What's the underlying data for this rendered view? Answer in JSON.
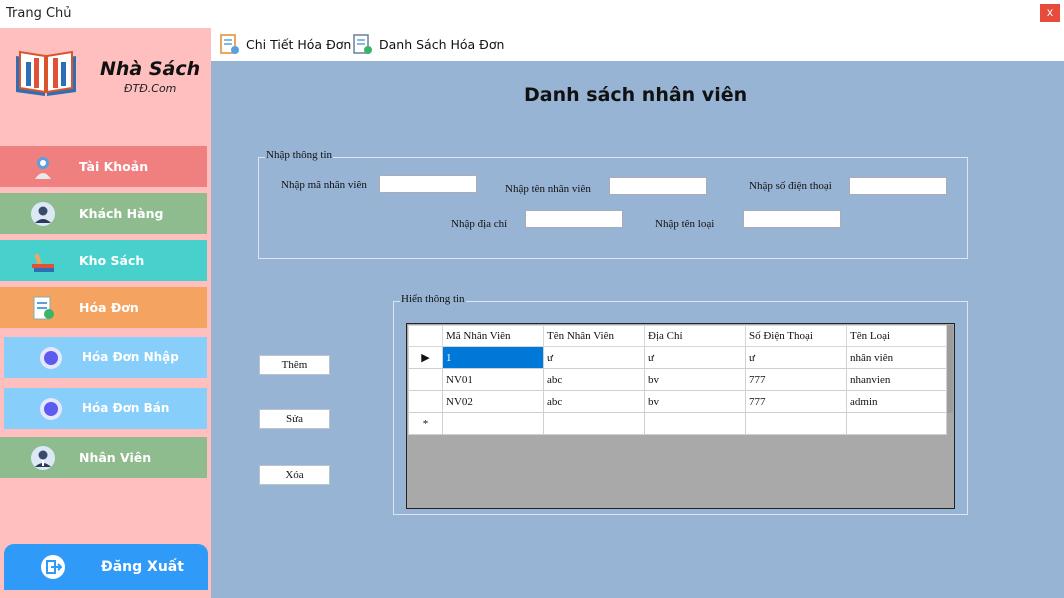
{
  "window": {
    "title": "Trang Chủ",
    "close_glyph": "x"
  },
  "brand": {
    "name": "Nhà Sách",
    "sub": "ĐTĐ.Com",
    "logo_icon": "book-logo-icon"
  },
  "sidebar": {
    "items": [
      {
        "label": "Tài Khoản",
        "icon": "account-icon",
        "color": "#f08080"
      },
      {
        "label": "Khách Hàng",
        "icon": "customer-icon",
        "color": "#8fbc8f"
      },
      {
        "label": "Kho Sách",
        "icon": "books-icon",
        "color": "#48d1cc"
      },
      {
        "label": "Hóa Đơn",
        "icon": "invoice-icon",
        "color": "#f4a460"
      },
      {
        "label": "Hóa Đơn Nhập",
        "icon": "circle-icon",
        "color": "#87cefa"
      },
      {
        "label": "Hóa Đơn Bán",
        "icon": "circle-icon",
        "color": "#87cefa"
      },
      {
        "label": "Nhân Viên",
        "icon": "employee-icon",
        "color": "#8fbc8f"
      }
    ],
    "logout": {
      "label": "Đăng Xuất",
      "color": "#2f9af7",
      "icon": "logout-icon"
    }
  },
  "toolbar": {
    "invoice_detail": "Chi Tiết Hóa Đơn",
    "invoice_list": "Danh Sách Hóa Đơn"
  },
  "main": {
    "heading": "Danh sách nhân viên",
    "input_group": {
      "legend": "Nhập thông tin",
      "id_label": "Nhập mã nhân viên",
      "name_label": "Nhập tên nhân viên",
      "phone_label": "Nhập số điện thoại",
      "address_label": "Nhập địa chỉ",
      "type_label": "Nhập tên loại",
      "id_value": "",
      "name_value": "",
      "phone_value": "",
      "address_value": "",
      "type_value": ""
    },
    "buttons": {
      "add": "Thêm",
      "edit": "Sửa",
      "delete": "Xóa"
    },
    "display_group": {
      "legend": "Hiển thông tin"
    },
    "table": {
      "columns": [
        "Mã Nhân Viên",
        "Tên Nhân Viên",
        "Địa Chỉ",
        "Số Điện Thoại",
        "Tên Loại"
      ],
      "rows": [
        [
          "1",
          "ư",
          "ư",
          "ư",
          "nhân viên"
        ],
        [
          "NV01",
          "abc",
          "bv",
          "777",
          "nhanvien"
        ],
        [
          "NV02",
          "abc",
          "bv",
          "777",
          "admin"
        ]
      ],
      "current_row_marker": "▶",
      "new_row_marker": "*"
    }
  },
  "colors": {
    "content_bg": "#98b4d4",
    "sidebar_bg": "#ffbfbf",
    "selection": "#0078d7"
  }
}
